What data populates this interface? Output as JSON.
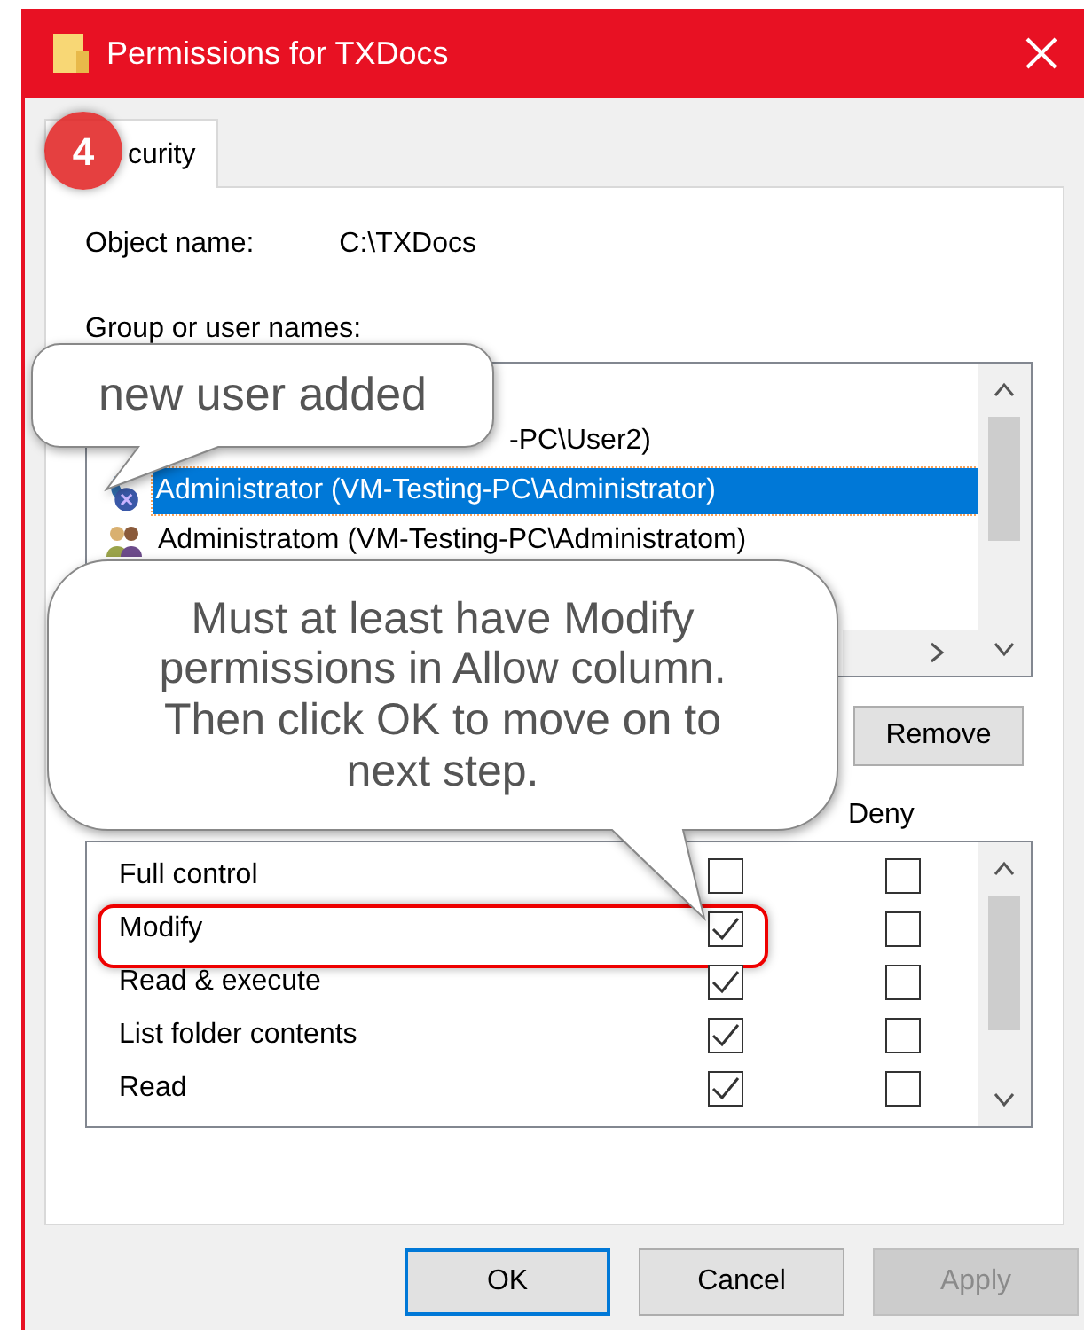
{
  "window": {
    "title": "Permissions for TXDocs"
  },
  "step_badge": "4",
  "tabs": [
    {
      "label": "curity",
      "selected": true
    }
  ],
  "object_name": {
    "label": "Object name:",
    "value": "C:\\TXDocs"
  },
  "users": {
    "label": "Group or user names:",
    "items": [
      {
        "name": "-PC\\User2)",
        "kind": "user",
        "selected": false
      },
      {
        "name": "Administrator (VM-Testing-PC\\Administrator)",
        "kind": "admin",
        "selected": true
      },
      {
        "name": "Administratom (VM-Testing-PC\\Administratom)",
        "kind": "group",
        "selected": false
      }
    ]
  },
  "remove_button": "Remove",
  "permissions": {
    "deny_label": "Deny",
    "rows": [
      {
        "name": "Full control",
        "allow": false,
        "deny": false,
        "highlighted": false
      },
      {
        "name": "Modify",
        "allow": true,
        "deny": false,
        "highlighted": true
      },
      {
        "name": "Read & execute",
        "allow": true,
        "deny": false,
        "highlighted": false
      },
      {
        "name": "List folder contents",
        "allow": true,
        "deny": false,
        "highlighted": false
      },
      {
        "name": "Read",
        "allow": true,
        "deny": false,
        "highlighted": false
      }
    ]
  },
  "buttons": [
    {
      "label": "OK",
      "default": true,
      "disabled": false
    },
    {
      "label": "Cancel",
      "default": false,
      "disabled": false
    },
    {
      "label": "Apply",
      "default": false,
      "disabled": true
    }
  ],
  "callouts": [
    {
      "text": "new user added"
    },
    {
      "text": "Must at least have Modify permissions in Allow column. Then click OK to move on to next step."
    }
  ]
}
